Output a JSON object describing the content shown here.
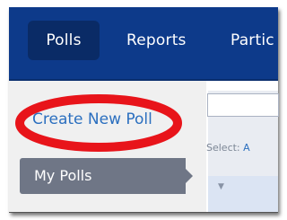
{
  "nav": {
    "items": [
      {
        "label": "Polls",
        "active": true
      },
      {
        "label": "Reports"
      },
      {
        "label": "Partic"
      }
    ]
  },
  "sidebar": {
    "create_link": "Create New Poll",
    "my_polls": "My Polls"
  },
  "filter": {
    "select_label": "Select:",
    "select_option": "A"
  },
  "colors": {
    "nav_bg": "#0d3a8a",
    "nav_active": "#0a2b66",
    "link": "#2b6fbf",
    "highlight_oval": "#e8141a",
    "sidebar_active": "#6f7686"
  },
  "icons": {
    "collapse": "chevron-down-icon"
  }
}
